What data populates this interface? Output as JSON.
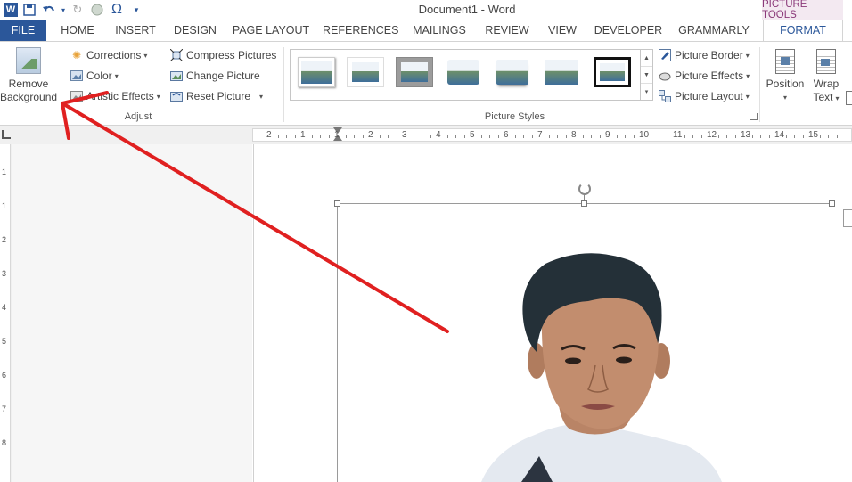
{
  "app": {
    "title": "Document1 - Word",
    "logo_letter": "W",
    "context_tab_group": "PICTURE TOOLS"
  },
  "qat": {
    "save_icon": "save-icon",
    "undo_icon": "undo-icon",
    "redo_icon": "redo-icon",
    "symbol_glyph": "Ω",
    "more_glyph": "▾"
  },
  "tabs": [
    {
      "label": "FILE"
    },
    {
      "label": "HOME"
    },
    {
      "label": "INSERT"
    },
    {
      "label": "DESIGN"
    },
    {
      "label": "PAGE LAYOUT"
    },
    {
      "label": "REFERENCES"
    },
    {
      "label": "MAILINGS"
    },
    {
      "label": "REVIEW"
    },
    {
      "label": "VIEW"
    },
    {
      "label": "DEVELOPER"
    },
    {
      "label": "GRAMMARLY"
    },
    {
      "label": "FORMAT"
    }
  ],
  "ribbon": {
    "adjust": {
      "remove_background_line1": "Remove",
      "remove_background_line2": "Background",
      "corrections": "Corrections",
      "color": "Color",
      "artistic_effects": "Artistic Effects",
      "compress_pictures": "Compress Pictures",
      "change_picture": "Change Picture",
      "reset_picture": "Reset Picture",
      "group_label": "Adjust"
    },
    "picture_styles": {
      "picture_border": "Picture Border",
      "picture_effects": "Picture Effects",
      "picture_layout": "Picture Layout",
      "group_label": "Picture Styles"
    },
    "arrange": {
      "position": "Position",
      "wrap_line1": "Wrap",
      "wrap_line2": "Text"
    }
  },
  "ruler": {
    "h_labels": [
      "2",
      "1",
      "1",
      "2",
      "3",
      "4",
      "5",
      "6",
      "7",
      "8",
      "9",
      "10",
      "11",
      "12",
      "13",
      "14",
      "15"
    ],
    "v_labels": [
      "1",
      "1",
      "2",
      "3",
      "4",
      "5",
      "6",
      "7",
      "8"
    ]
  },
  "colors": {
    "accent": "#2b579a",
    "context_tab": "#8b3a7a",
    "arrow": "#e02020"
  }
}
